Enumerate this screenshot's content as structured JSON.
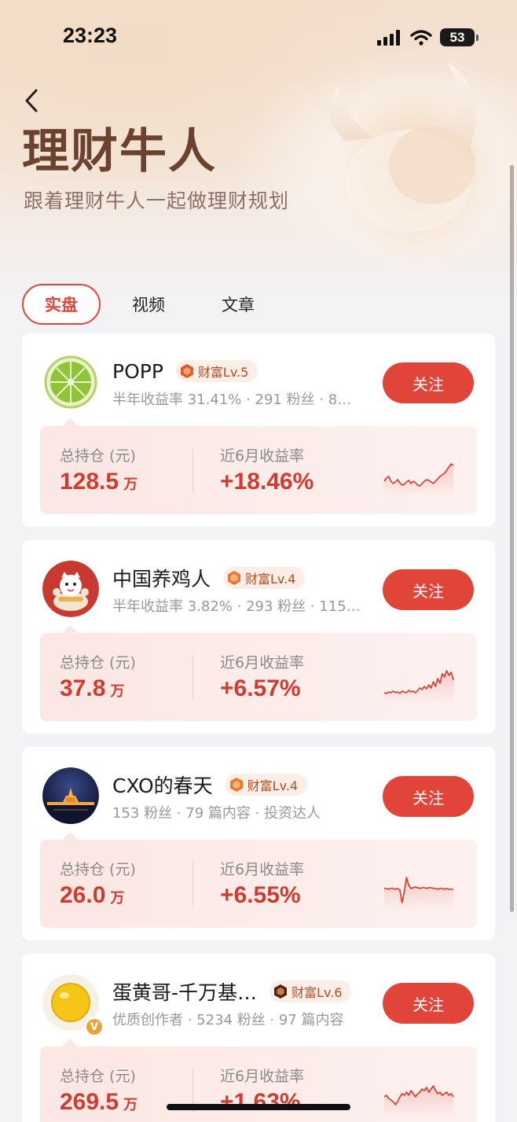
{
  "status_bar": {
    "time": "23:23",
    "battery": "53"
  },
  "header": {
    "title": "理财牛人",
    "subtitle": "跟着理财牛人一起做理财规划"
  },
  "tabs": [
    {
      "label": "实盘",
      "active": true
    },
    {
      "label": "视频",
      "active": false
    },
    {
      "label": "文章",
      "active": false
    }
  ],
  "stat_labels": {
    "holding": "总持仓 (元)",
    "return": "近6月收益率"
  },
  "users": [
    {
      "name": "POPP",
      "level": "财富Lv.5",
      "meta": "半年收益率 31.41% · 291 粉丝 · 8…",
      "follow_label": "关注",
      "holding_value": "128.5",
      "holding_unit": "万",
      "return_6m": "+18.46%",
      "avatar": "lime-avatar",
      "sparkline": [
        30,
        26,
        24,
        30,
        33,
        31,
        28,
        32,
        35,
        34,
        31,
        29,
        33,
        30,
        32,
        35,
        36,
        33,
        30,
        28,
        29,
        31,
        33,
        30,
        27,
        24,
        22,
        20,
        16,
        12,
        8,
        10
      ]
    },
    {
      "name": "中国养鸡人",
      "level": "财富Lv.4",
      "meta": "半年收益率 3.82% · 293 粉丝 · 115…",
      "follow_label": "关注",
      "holding_value": "37.8",
      "holding_unit": "万",
      "return_6m": "+6.57%",
      "avatar": "lucky-cat-avatar",
      "sparkline": [
        36,
        37,
        35,
        36,
        34,
        36,
        35,
        37,
        34,
        35,
        36,
        33,
        35,
        34,
        36,
        33,
        30,
        32,
        28,
        31,
        26,
        30,
        22,
        28,
        18,
        24,
        12,
        16,
        8,
        14,
        10,
        20
      ]
    },
    {
      "name": "CXO的春天",
      "level": "财富Lv.4",
      "meta": "153 粉丝 · 79 篇内容 · 投资达人",
      "follow_label": "关注",
      "holding_value": "26.0",
      "holding_unit": "万",
      "return_6m": "+6.55%",
      "avatar": "night-pagoda-avatar",
      "sparkline": [
        22,
        22,
        23,
        22,
        22,
        23,
        22,
        24,
        40,
        26,
        8,
        18,
        22,
        21,
        20,
        21,
        22,
        21,
        21,
        22,
        21,
        21,
        22,
        22,
        23,
        22,
        22,
        23,
        22,
        23,
        23,
        23
      ]
    },
    {
      "name": "蛋黄哥-千万基…",
      "level": "财富Lv.6",
      "meta": "优质创作者 · 5234 粉丝 · 97 篇内容",
      "follow_label": "关注",
      "holding_value": "269.5",
      "holding_unit": "万",
      "return_6m": "+1.63%",
      "avatar": "egg-yolk-avatar",
      "sparkline": [
        24,
        22,
        26,
        28,
        30,
        34,
        30,
        24,
        20,
        22,
        18,
        22,
        16,
        20,
        24,
        20,
        18,
        14,
        16,
        12,
        18,
        14,
        10,
        16,
        20,
        18,
        22,
        20,
        18,
        22,
        20,
        24
      ]
    }
  ]
}
